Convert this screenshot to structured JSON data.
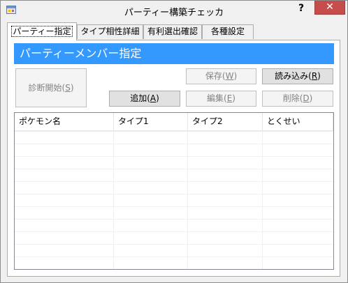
{
  "window": {
    "title": "パーティー構築チェッカ",
    "help_label": "?",
    "close_label": "✕"
  },
  "tabs": [
    {
      "label": "パーティー指定",
      "active": true
    },
    {
      "label": "タイプ相性詳細",
      "active": false
    },
    {
      "label": "有利選出確認",
      "active": false
    },
    {
      "label": "各種設定",
      "active": false
    }
  ],
  "panel": {
    "banner": "パーティーメンバー指定",
    "buttons": {
      "diagnose": {
        "text": "診断開始(",
        "key": "S",
        "end": ")"
      },
      "save": {
        "text": "保存(",
        "key": "W",
        "end": ")"
      },
      "load": {
        "text": "読み込み(",
        "key": "R",
        "end": ")"
      },
      "add": {
        "text": "追加(",
        "key": "A",
        "end": ")"
      },
      "edit": {
        "text": "編集(",
        "key": "E",
        "end": ")"
      },
      "delete": {
        "text": "削除(",
        "key": "D",
        "end": ")"
      }
    },
    "list": {
      "columns": [
        "ポケモン名",
        "タイプ1",
        "タイプ2",
        "とくせい"
      ]
    }
  },
  "colors": {
    "accent": "#3399ff",
    "close": "#c74d4d"
  }
}
